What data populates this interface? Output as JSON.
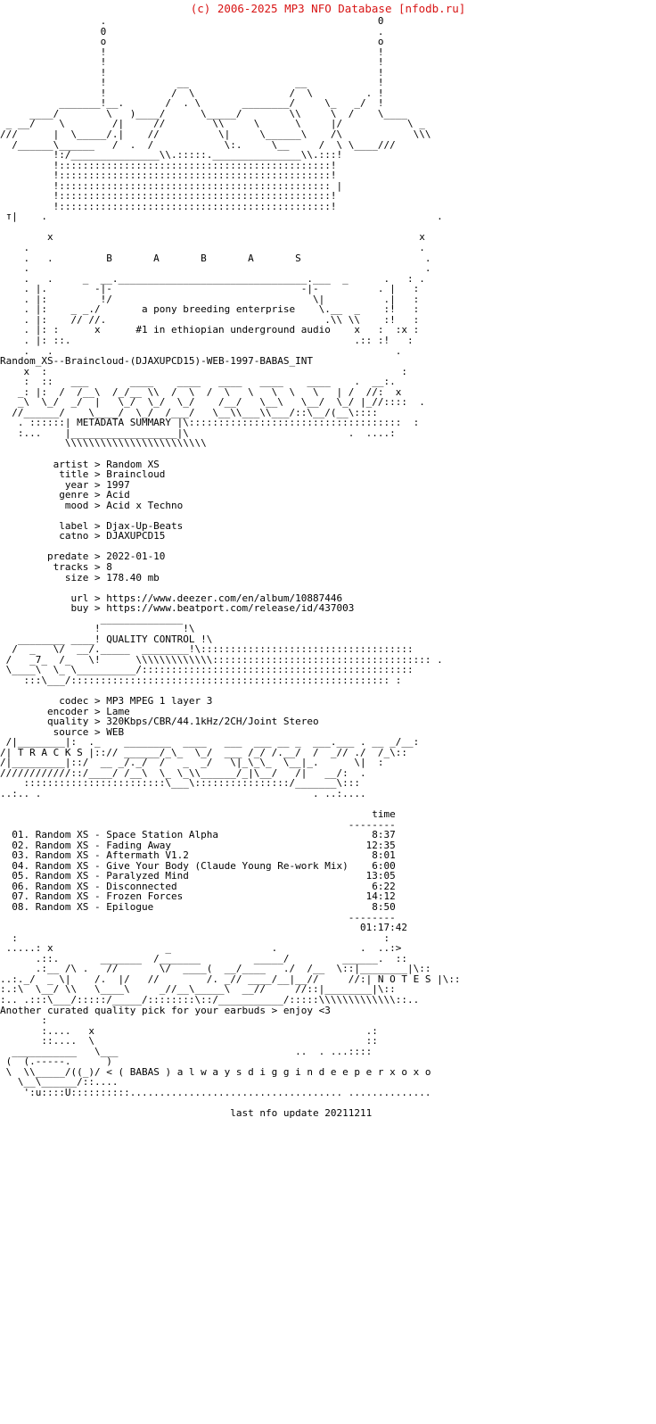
{
  "site_banner": "(c) 2006-2025 MP3 NFO Database [nfodb.ru]",
  "site_banner_color": "#d81414",
  "header": {
    "logo_art": "                 .                                              0\n                 0                                              .\n                 o                                              o\n                 !                                              !\n                 !                                              !\n                 !             __                 __            !\n                 !            /  \\               /  \\        _  !   .\n            _____!__.     ____/ . \\____      ____/.   \\__   _ !_/ \\/\n      _____/      \\   )__/ /      \\    \\____/     \\\\   \\ !_/  \\____\n  _ __ /   \\      / |    //        \\\\       \\    /  \\   |/        \\____ _\n ///  |     \\____/ .|   //          \\|       \\__/    \\__/ \\         \\\\\\\n  /___\\_____      /  . /             \\:.      \\__     / _\\ \\___///\n         !:/______________\\\\.::::.______________\\\\.:::!\n         !::::::::::::::::::::::::::::::::::::::::::::!\n         !::::::::::::::::::::::::::::::::::::::::::::!\n         !:::::::::::::::::::::::::::::::::::::::::::: |\n         !::::::::::::::::::::::::::::::::::::::::::::!",
    "left_mark": "т|",
    "left_dot": ".",
    "left_x": "x",
    "right_dot": ".",
    "right_x": "x",
    "brand_letters": "B     A     B     A     S",
    "tagline_1": "a pony breeding enterprise",
    "tagline_2": "#1 in ethiopian underground audio",
    "frame_art": "  .                                                                .\n  .   .                                                      .     .\n  .                                                                .\n  .   .        _  __.______________________________.___  _     .   .\n  . |.          -|-                                -|            . | .\n  . |:          !/                                  \\|            :! .\n  . |:       _ _./                                   \\.__  _      :! .\n  . |:      // //.                                    .\\\\ \\\\       :! .\n  . |: :       x                                        x      :  :x .\n  . |: ::.                                                 .:: :! .\n  .   .                                                         ."
  },
  "release_title": "Random_XS--Braincloud-(DJAXUPCD15)-WEB-1997-BABAS_INT",
  "sections": {
    "metadata": {
      "label": "METADATA SUMMARY",
      "banner_art": "   x  :                                                              :\n   :  ::  ___        ____   ____   ____   ____   ____    ____   .__:.\n   _: |: /  /__\\  /_/__  \\\\  /  \\  /  \\  \\  \\  \\  \\   \\   | /  //:  x\n   _\\ \\_/ _/        \\_/  \\_/  \\_/   /__/   \\__\\  \\__/  \\_/  |_ //::::  .\n  //______/          \\__/  \\_/     /___/   \\__\\   \\__/  /::\\__/(__\\::::\n  . ::::::| METADATA SUMMARY |\\:::::::::::::::::::::::::::::::::::::::  :\n  :...    |__________________|\\                              .  ....:\n          \\\\\\\\\\\\\\\\\\\\\\\\\\\\\\\\\\\\"
    },
    "quality": {
      "label": "QUALITY CONTROL",
      "banner_art": "                  ______________\n                 !              !\\\n   ________ _____! QUALITY CONTROL !\\\n  /  _   \\/  __/.______ ________!\\::::::::::::::::::::::::::::::::::\n /  _7_  /_   \\!      \\\\\\\\\\\\\\\\\\\\\\\\::::::::::::::::::::::::::::::::::: .\n \\____\\  \\_ \\__________/::::::::::::::::::::::::::::::::::::::::::::\n    :::\\___/::::::::::::::::::::::::::::::::::::::::::::::::::::: :"
    },
    "tracks": {
      "label": "T R A C K S",
      "banner_art": " /|________|:  ._    _______ ____   ___  ___ __ _  ___.___ . __ _/__:\n/| T R A C K S |::// ______/_\\_ \\_/ ___ /_/ /.__/ / _// ./   /_\\::\n/|_________|::/ __ _/._/  /  _ _/  \\|_\\_\\_ \\__|_.     \\| :\n////////////::/____/ /__\\ \\_ \\_\\\\______/_|\\__/  /|   __/: .\n   :::::::::::::::::::::::\\___\\:::::::::::::::/_______\\:::\n..:.. .                                             . ..:...."
    },
    "notes": {
      "label": "N O T E S",
      "banner_art": " :                                                            :\n .....: x                  _                .            .  ..:>\n      .::.      _______ /_______        ____/         ______.  ::\n      .:__ /\\ .  //      \\/ ____( __/____   ./  /__ \\::|________|\\::\n..:._/  _ \\|   /. |/   //       /. _// ___/__|__//    //:| N O T E S |\\::\n:.:\\ \\__/ \\\\  \\____\\    _//__\\____\\ __//    //::|________|\\::\n:.. .:::\\___/::::::/____/:::::::\\::/__________/:::::\\\\\\\\\\\\\\\\\\\\\\\\::..",
      "text": "Another curated quality pick for your earbuds > enjoy <3"
    },
    "footer": {
      "babas_art": "      :\n      :....  x                                              .:\n      ::.... \\                                              ::\n  __________  \\___                           ..   . ...::::\n (  (.-----.    )\n  \\  \\\\_____/((_)/",
      "tag": "< ( BABAS ) a l w a y s d i g g i n d e e p e r x o x o",
      "bottom_art": "   \\__\\______/::....\n    ':u::::U:::::::::...........................................",
      "last_update": "last nfo update 20211211"
    }
  },
  "metadata_fields": [
    {
      "key": "artist",
      "value": "Random XS"
    },
    {
      "key": "title",
      "value": "Braincloud"
    },
    {
      "key": "year",
      "value": "1997"
    },
    {
      "key": "genre",
      "value": "Acid"
    },
    {
      "key": "mood",
      "value": "Acid x Techno"
    },
    {
      "key": "",
      "value": ""
    },
    {
      "key": "label",
      "value": "Djax-Up-Beats"
    },
    {
      "key": "catno",
      "value": "DJAXUPCD15"
    },
    {
      "key": "",
      "value": ""
    },
    {
      "key": "predate",
      "value": "2022-01-10"
    },
    {
      "key": "tracks",
      "value": "8"
    },
    {
      "key": "size",
      "value": "178.40 mb"
    },
    {
      "key": "",
      "value": ""
    },
    {
      "key": "url",
      "value": "https://www.deezer.com/en/album/10887446"
    },
    {
      "key": "buy",
      "value": "https://www.beatport.com/release/id/437003"
    }
  ],
  "quality_fields": [
    {
      "key": "codec",
      "value": "MP3 MPEG 1 layer 3"
    },
    {
      "key": "encoder",
      "value": "Lame"
    },
    {
      "key": "quality",
      "value": "320Kbps/CBR/44.1kHz/2CH/Joint Stereo"
    },
    {
      "key": "source",
      "value": "WEB"
    }
  ],
  "tracklist": {
    "time_header": "time",
    "rule": "--------",
    "total": "01:17:42",
    "items": [
      {
        "num": "01.",
        "artist": "Random XS",
        "title": "Space Station Alpha",
        "time": "8:37"
      },
      {
        "num": "02.",
        "artist": "Random XS",
        "title": "Fading Away",
        "time": "12:35"
      },
      {
        "num": "03.",
        "artist": "Random XS",
        "title": "Aftermath V1.2",
        "time": "8:01"
      },
      {
        "num": "04.",
        "artist": "Random XS",
        "title": "Give Your Body (Claude Young Re-work Mix)",
        "time": "6:00"
      },
      {
        "num": "05.",
        "artist": "Random XS",
        "title": "Paralyzed Mind",
        "time": "13:05"
      },
      {
        "num": "06.",
        "artist": "Random XS",
        "title": "Disconnected",
        "time": "6:22"
      },
      {
        "num": "07.",
        "artist": "Random XS",
        "title": "Frozen Forces",
        "time": "14:12"
      },
      {
        "num": "08.",
        "artist": "Random XS",
        "title": "Epilogue",
        "time": "8:50"
      }
    ]
  }
}
